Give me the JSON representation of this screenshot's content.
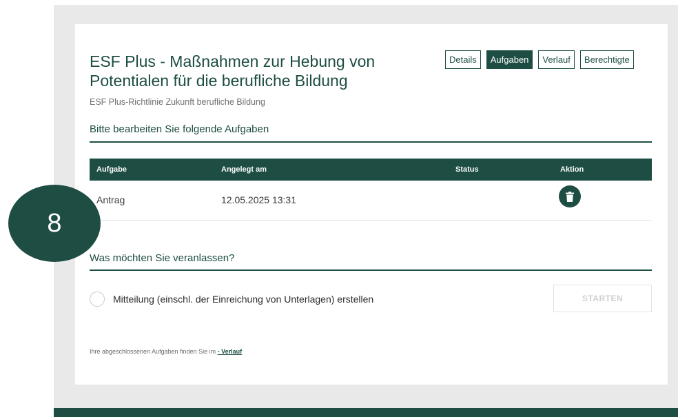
{
  "header": {
    "title": "ESF Plus - Maßnahmen zur Hebung von Potentialen für die berufliche Bildung",
    "subtitle": "ESF Plus-Richtlinie Zukunft berufliche Bildung"
  },
  "tabs": [
    {
      "label": "Details",
      "active": false
    },
    {
      "label": "Aufgaben",
      "active": true
    },
    {
      "label": "Verlauf",
      "active": false
    },
    {
      "label": "Berechtigte",
      "active": false
    }
  ],
  "tasks": {
    "heading": "Bitte bearbeiten Sie folgende Aufgaben",
    "columns": [
      "Aufgabe",
      "Angelegt am",
      "Status",
      "Aktion"
    ],
    "rows": [
      {
        "task": "Antrag",
        "created": "12.05.2025 13:31",
        "status": "",
        "action_icon": "trash-icon"
      }
    ]
  },
  "actions": {
    "heading": "Was möchten Sie veranlassen?",
    "option_label": "Mitteilung (einschl. der Einreichung von Unterlagen) erstellen",
    "start_label": "STARTEN"
  },
  "footnote": {
    "text": "Ihre abgeschlossenen Aufgaben finden Sie im ",
    "link": "- Verlauf"
  },
  "badge": {
    "number": "8"
  },
  "colors": {
    "primary": "#1d4d43",
    "background": "#e9e9e9"
  }
}
